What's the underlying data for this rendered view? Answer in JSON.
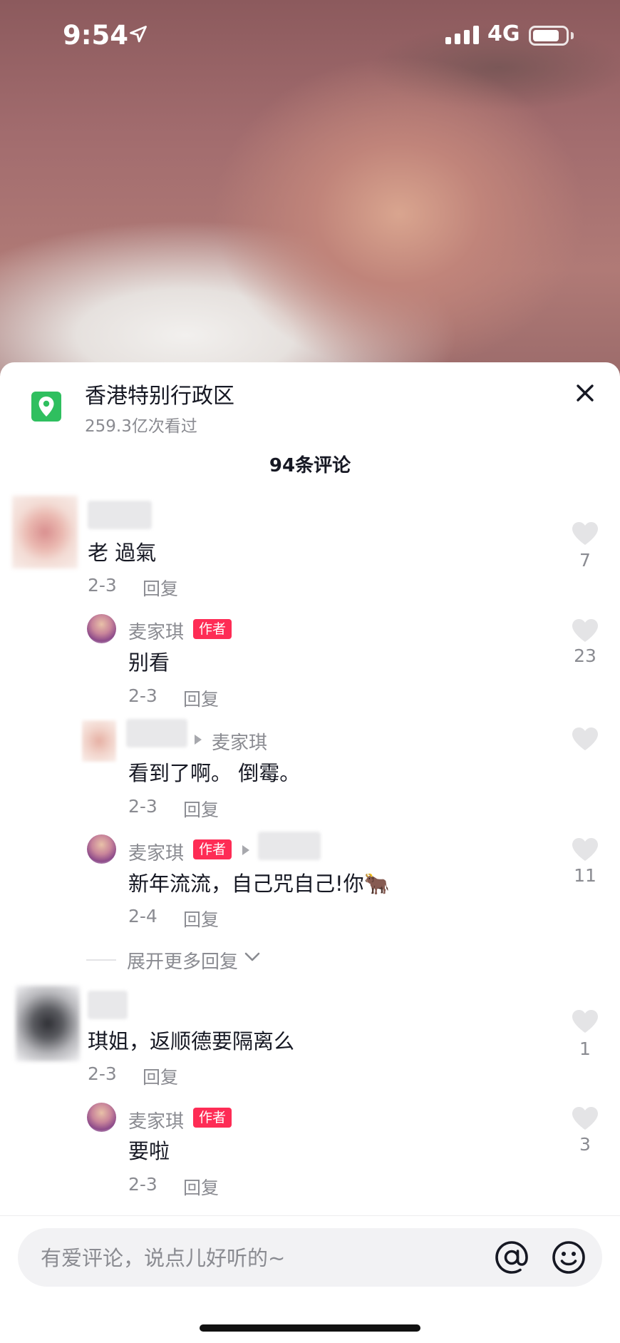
{
  "status_bar": {
    "time": "9:54",
    "network": "4G"
  },
  "location": {
    "title": "香港特别行政区",
    "views": "259.3亿次看过"
  },
  "comments_count": "94条评论",
  "comments": [
    {
      "text": "老 過氣",
      "date": "2-3",
      "reply_label": "回复",
      "likes": "7"
    },
    {
      "author": "麦家琪",
      "badge": "作者",
      "text": "别看",
      "date": "2-3",
      "reply_label": "回复",
      "likes": "23"
    },
    {
      "reply_to": "麦家琪",
      "text": "看到了啊。 倒霉。",
      "date": "2-3",
      "reply_label": "回复",
      "likes": ""
    },
    {
      "author": "麦家琪",
      "badge": "作者",
      "text": "新年流流，自己咒自己!你🐂",
      "date": "2-4",
      "reply_label": "回复",
      "likes": "11"
    },
    {
      "text": "琪姐，返顺德要隔离么",
      "date": "2-3",
      "reply_label": "回复",
      "likes": "1"
    },
    {
      "author": "麦家琪",
      "badge": "作者",
      "text": "要啦",
      "date": "2-3",
      "reply_label": "回复",
      "likes": "3"
    }
  ],
  "expand_replies": "展开更多回复",
  "input": {
    "placeholder": "有爱评论，说点儿好听的~"
  },
  "icons": {
    "location": "map-pin-icon",
    "close": "close-icon",
    "like": "heart-icon",
    "mention": "at-icon",
    "emoji": "emoji-icon",
    "expand": "chevron-down-icon",
    "reply_arrow": "triangle-right-icon"
  },
  "colors": {
    "author_badge": "#fe2c55",
    "location_icon": "#2fbf5f",
    "muted_text": "#8a8b91"
  }
}
